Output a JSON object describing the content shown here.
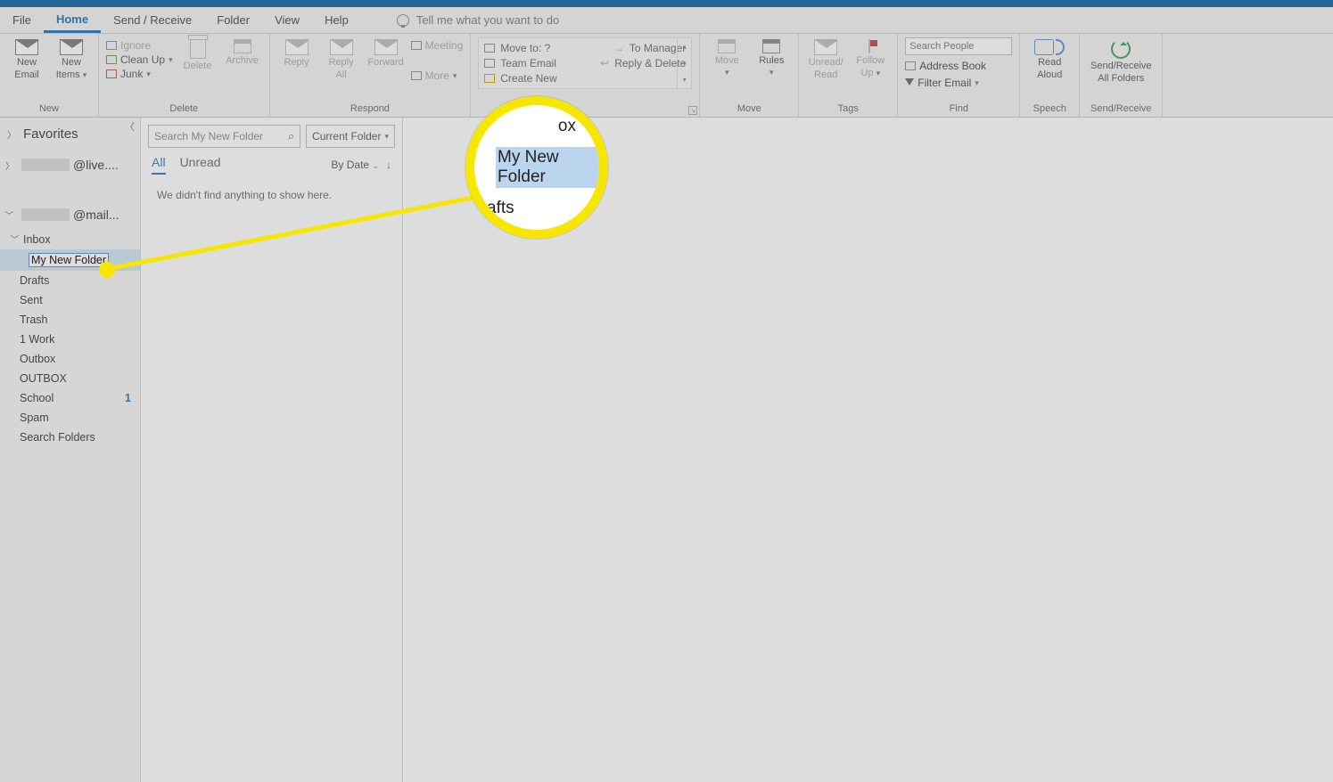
{
  "tabs": {
    "file": "File",
    "home": "Home",
    "sendrecv": "Send / Receive",
    "folder": "Folder",
    "view": "View",
    "help": "Help",
    "tellme": "Tell me what you want to do"
  },
  "ribbon": {
    "new": {
      "label": "New",
      "newEmail1": "New",
      "newEmail2": "Email",
      "newItems1": "New",
      "newItems2": "Items"
    },
    "delete": {
      "label": "Delete",
      "ignore": "Ignore",
      "cleanup": "Clean Up",
      "junk": "Junk",
      "delete": "Delete",
      "archive": "Archive"
    },
    "respond": {
      "label": "Respond",
      "reply": "Reply",
      "replyAll1": "Reply",
      "replyAll2": "All",
      "forward": "Forward",
      "meeting": "Meeting",
      "more": "More"
    },
    "quick": {
      "moveTo": "Move to: ?",
      "toManager": "To Manager",
      "teamEmail": "Team Email",
      "replyDelete": "Reply & Delete",
      "createNew": "Create New"
    },
    "move": {
      "label": "Move",
      "move": "Move",
      "rules": "Rules"
    },
    "tags": {
      "label": "Tags",
      "unread1": "Unread/",
      "unread2": "Read",
      "follow1": "Follow",
      "follow2": "Up"
    },
    "find": {
      "label": "Find",
      "searchPlaceholder": "Search People",
      "address": "Address Book",
      "filter": "Filter Email"
    },
    "speech": {
      "label": "Speech",
      "read1": "Read",
      "read2": "Aloud"
    },
    "sr": {
      "label": "Send/Receive",
      "sr1": "Send/Receive",
      "sr2": "All Folders"
    }
  },
  "nav": {
    "favorites": "Favorites",
    "acct1": "@live....",
    "acct2": "@mail...",
    "inbox": "Inbox",
    "newFolder": "My New Folder",
    "folders": [
      {
        "name": "Drafts"
      },
      {
        "name": "Sent"
      },
      {
        "name": "Trash"
      },
      {
        "name": "1 Work"
      },
      {
        "name": "Outbox"
      },
      {
        "name": "OUTBOX"
      },
      {
        "name": "School",
        "count": "1"
      },
      {
        "name": "Spam"
      },
      {
        "name": "Search Folders"
      }
    ]
  },
  "list": {
    "searchPlaceholder": "Search My New Folder",
    "scope": "Current Folder",
    "all": "All",
    "unread": "Unread",
    "sort": "By Date",
    "empty": "We didn't find anything to show here."
  },
  "callout": {
    "inbox": "ox",
    "mnf": "My New Folder",
    "drafts": "afts"
  }
}
